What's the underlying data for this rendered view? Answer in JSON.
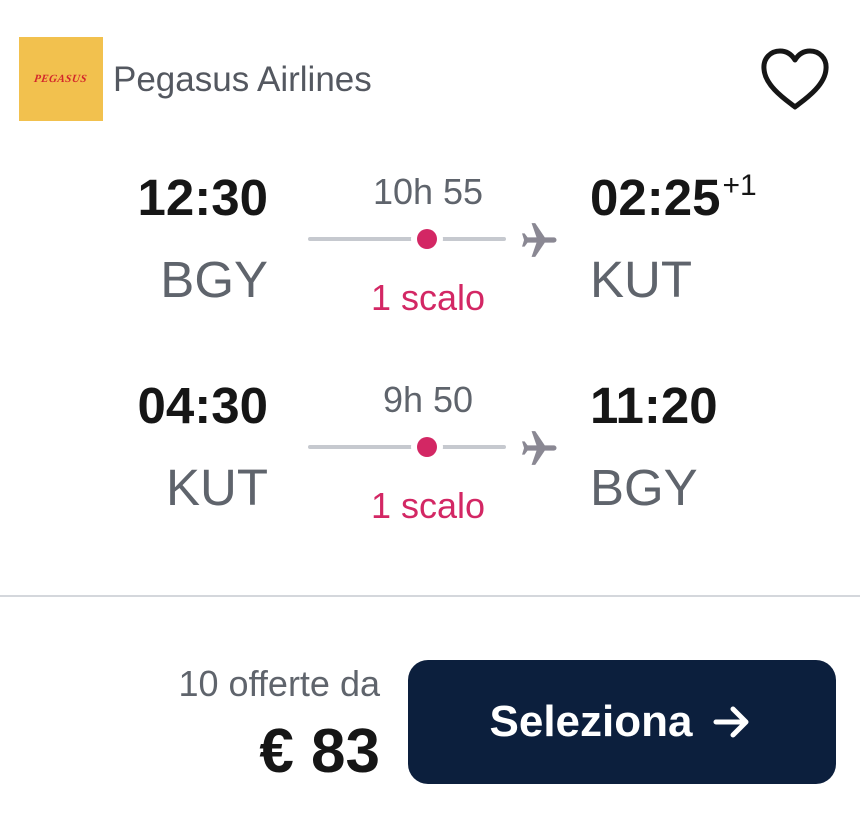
{
  "airline": {
    "logo_text": "PEGASUS",
    "name": "Pegasus Airlines",
    "logo_bg": "#f2c14e",
    "logo_fg": "#d3262b"
  },
  "favorite": {
    "icon": "heart-outline-icon"
  },
  "outbound": {
    "departure_time": "12:30",
    "departure_airport": "BGY",
    "duration": "10h 55",
    "stops": "1 scalo",
    "arrival_time": "02:25",
    "day_offset": "+1",
    "arrival_airport": "KUT"
  },
  "return": {
    "departure_time": "04:30",
    "departure_airport": "KUT",
    "duration": "9h 50",
    "stops": "1 scalo",
    "arrival_time": "11:20",
    "arrival_airport": "BGY"
  },
  "footer": {
    "offers_label": "10 offerte da",
    "price": "€ 83",
    "select_label": "Seleziona"
  },
  "colors": {
    "accent_stop": "#d32764",
    "button_bg": "#0c1f3d",
    "text_muted": "#5f646c"
  }
}
